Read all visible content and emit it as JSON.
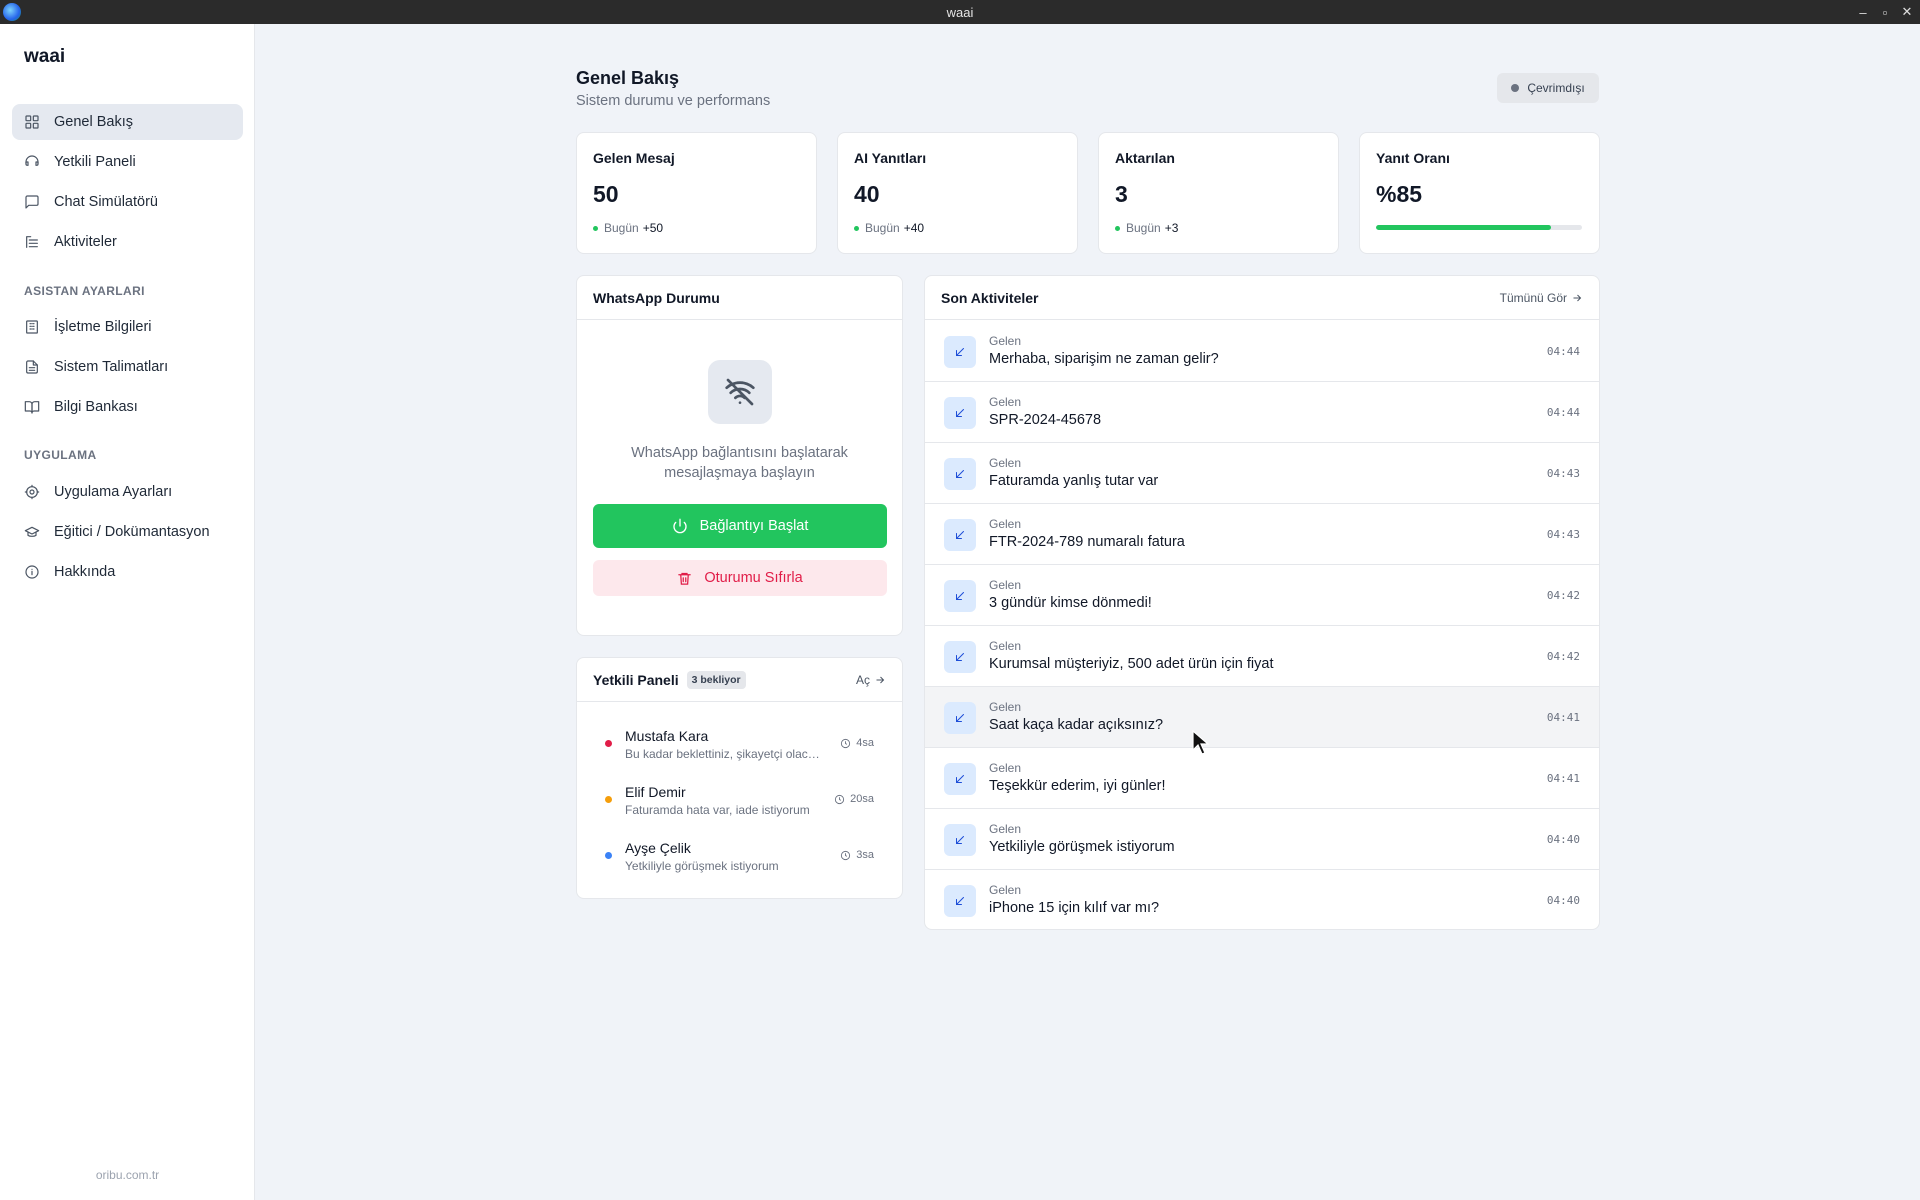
{
  "window": {
    "title": "waai",
    "controls": [
      "–",
      "▫",
      "✕"
    ]
  },
  "sidebar": {
    "brand": "waai",
    "items": [
      {
        "label": "Genel Bakış",
        "icon": "grid-icon",
        "active": true
      },
      {
        "label": "Yetkili Paneli",
        "icon": "headset-icon"
      },
      {
        "label": "Chat Simülatörü",
        "icon": "chat-icon"
      },
      {
        "label": "Aktiviteler",
        "icon": "list-icon"
      }
    ],
    "section_assistant": "ASISTAN AYARLARI",
    "assistant_items": [
      {
        "label": "İşletme Bilgileri",
        "icon": "building-icon"
      },
      {
        "label": "Sistem Talimatları",
        "icon": "document-icon"
      },
      {
        "label": "Bilgi Bankası",
        "icon": "book-icon"
      }
    ],
    "section_app": "UYGULAMA",
    "app_items": [
      {
        "label": "Uygulama Ayarları",
        "icon": "gear-icon"
      },
      {
        "label": "Eğitici / Dokümantasyon",
        "icon": "graduation-cap-icon"
      },
      {
        "label": "Hakkında",
        "icon": "info-icon"
      }
    ],
    "footer": "oribu.com.tr"
  },
  "header": {
    "title": "Genel Bakış",
    "subtitle": "Sistem durumu ve performans",
    "status": "Çevrimdışı"
  },
  "stats": [
    {
      "label": "Gelen Mesaj",
      "value": "50",
      "sub_label": "Bugün",
      "sub_value": "+50"
    },
    {
      "label": "AI Yanıtları",
      "value": "40",
      "sub_label": "Bugün",
      "sub_value": "+40"
    },
    {
      "label": "Aktarılan",
      "value": "3",
      "sub_label": "Bugün",
      "sub_value": "+3"
    },
    {
      "label": "Yanıt Oranı",
      "value": "%85",
      "progress": 0.85
    }
  ],
  "whatsapp": {
    "title": "WhatsApp Durumu",
    "message": "WhatsApp bağlantısını başlatarak mesajlaşmaya başlayın",
    "connect_label": "Bağlantıyı Başlat",
    "reset_label": "Oturumu Sıfırla"
  },
  "agent_panel": {
    "title": "Yetkili Paneli",
    "badge": "3 bekliyor",
    "open_label": "Aç",
    "items": [
      {
        "name": "Mustafa Kara",
        "message": "Bu kadar beklettiniz, şikayetçi olacağım",
        "time": "4sa",
        "color": "#e11d48"
      },
      {
        "name": "Elif Demir",
        "message": "Faturamda hata var, iade istiyorum",
        "time": "20sa",
        "color": "#f59e0b"
      },
      {
        "name": "Ayşe Çelik",
        "message": "Yetkiliyle görüşmek istiyorum",
        "time": "3sa",
        "color": "#3b82f6"
      }
    ]
  },
  "activities": {
    "title": "Son Aktiviteler",
    "see_all": "Tümünü Gör",
    "items": [
      {
        "kind": "Gelen",
        "text": "Merhaba, siparişim ne zaman gelir?",
        "time": "04:44"
      },
      {
        "kind": "Gelen",
        "text": "SPR-2024-45678",
        "time": "04:44"
      },
      {
        "kind": "Gelen",
        "text": "Faturamda yanlış tutar var",
        "time": "04:43"
      },
      {
        "kind": "Gelen",
        "text": "FTR-2024-789 numaralı fatura",
        "time": "04:43"
      },
      {
        "kind": "Gelen",
        "text": "3 gündür kimse dönmedi!",
        "time": "04:42"
      },
      {
        "kind": "Gelen",
        "text": "Kurumsal müşteriyiz, 500 adet ürün için fiyat",
        "time": "04:42"
      },
      {
        "kind": "Gelen",
        "text": "Saat kaça kadar açıksınız?",
        "time": "04:41"
      },
      {
        "kind": "Gelen",
        "text": "Teşekkür ederim, iyi günler!",
        "time": "04:41"
      },
      {
        "kind": "Gelen",
        "text": "Yetkiliyle görüşmek istiyorum",
        "time": "04:40"
      },
      {
        "kind": "Gelen",
        "text": "iPhone 15 için kılıf var mı?",
        "time": "04:40"
      }
    ]
  }
}
